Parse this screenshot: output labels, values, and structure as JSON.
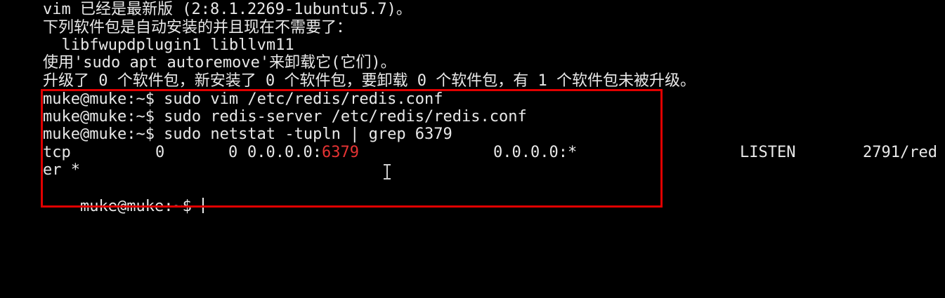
{
  "terminal": {
    "lines": {
      "l0": "vim 已经是最新版 (2:8.1.2269-1ubuntu5.7)。",
      "l1": "下列软件包是自动安装的并且现在不需要了：",
      "l2": "  libfwupdplugin1 libllvm11",
      "l3": "使用'sudo apt autoremove'来卸载它(它们)。",
      "l4": "升级了 0 个软件包，新安装了 0 个软件包，要卸载 0 个软件包，有 1 个软件包未被升级。",
      "l5": "muke@muke:~$ sudo vim /etc/redis/redis.conf",
      "l6": "muke@muke:~$ sudo redis-server /etc/redis/redis.conf",
      "l7": "muke@muke:~$ sudo netstat -tupln | grep 6379",
      "l9": "er *",
      "l10": "muke@muke:~$ "
    },
    "netstat": {
      "proto": "tcp",
      "recv_q": "0",
      "send_q": "0",
      "local_prefix": "0.0.0.0:",
      "local_port": "6379",
      "foreign": "0.0.0.0:*",
      "state": "LISTEN",
      "pid_program": "2791/red"
    },
    "colors": {
      "foreground": "#e8e8e8",
      "background": "#000000",
      "match_highlight": "#e53333",
      "annotation_box": "#e00000"
    }
  }
}
